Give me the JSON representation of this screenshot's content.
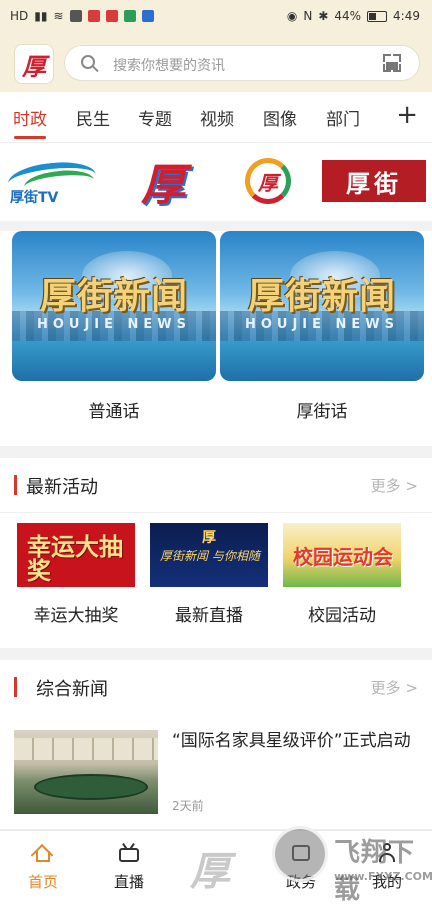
{
  "status_bar": {
    "network": "HD",
    "battery": "44%",
    "time": "4:49"
  },
  "header": {
    "logo_char": "厚",
    "search_placeholder": "搜索你想要的资讯"
  },
  "tabs": [
    {
      "label": "时政",
      "active": true
    },
    {
      "label": "民生"
    },
    {
      "label": "专题"
    },
    {
      "label": "视频"
    },
    {
      "label": "图像"
    },
    {
      "label": "部门"
    }
  ],
  "channels": {
    "tv_label": "厚街TV",
    "logo2_char": "厚",
    "logo3_char": "厚",
    "logo4_text": "厚街"
  },
  "video_cards": [
    {
      "title": "厚街新闻",
      "subtitle": "HOUJIE NEWS",
      "label": "普通话"
    },
    {
      "title": "厚街新闻",
      "subtitle": "HOUJIE NEWS",
      "label": "厚街话"
    }
  ],
  "sections": {
    "activities_title": "最新活动",
    "news_title": "综合新闻",
    "more_label": "更多 >"
  },
  "activities": [
    {
      "label": "幸运大抽奖",
      "thumb_text": "幸运大抽奖"
    },
    {
      "label": "最新直播",
      "thumb_text": "厚街新闻 与你相随"
    },
    {
      "label": "校园活动",
      "thumb_text": "校园运动会"
    }
  ],
  "news": [
    {
      "title": "“国际名家具星级评价”正式启动",
      "time": "2天前"
    }
  ],
  "bottom_nav": [
    {
      "label": "首页",
      "icon": "home-icon",
      "active": true
    },
    {
      "label": "直播",
      "icon": "live-icon"
    },
    {
      "label": "政务",
      "icon": "gov-icon"
    },
    {
      "label": "我的",
      "icon": "user-icon"
    }
  ],
  "watermark": {
    "name": "飞翔下载",
    "url": "www.FXXZ.COM"
  },
  "colors": {
    "accent": "#d33a2c",
    "nav_active": "#e0892a",
    "header_bg": "#f5efdc"
  }
}
